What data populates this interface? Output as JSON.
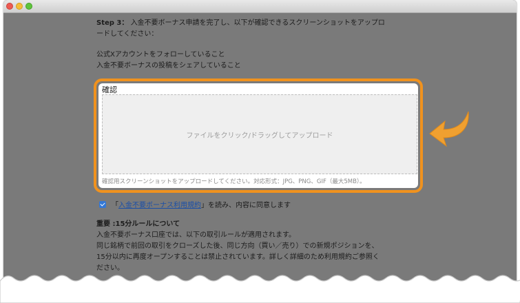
{
  "step": {
    "label": "Step 3",
    "colon": "：",
    "text_line1": "入金不要ボーナス申請を完了し、以下が確認できるスクリーンショットをアップロ",
    "text_line2": "ードしてください："
  },
  "requirements": [
    "公式Xアカウントをフォローしていること",
    "入金不要ボーナスの投稿をシェアしていること"
  ],
  "upload": {
    "label": "確認",
    "dropzone_text": "ファイルをクリック/ドラッグしてアップロード",
    "hint": "確認用スクリーンショットをアップロードしてください。対応形式：JPG、PNG、GIF（最大5MB）。"
  },
  "agreement": {
    "checked": true,
    "open_quote": "「",
    "link_text": "入金不要ボーナス利用規約",
    "close_quote": "」",
    "suffix": "を読み、内容に同意します"
  },
  "rule": {
    "heading": "重要 :15分ルールについて",
    "lines": [
      "入金不要ボーナス口座では、以下の取引ルールが適用されます。",
      "同じ銘柄で前回の取引をクローズした後、同じ方向（買い／売り）での新規ポジションを、",
      "15分以内に再度オープンすることは禁止されています。詳しく詳細のため利用規約ご参照く",
      "ださい。"
    ]
  },
  "colors": {
    "highlight": "#f0921e",
    "arrow": "#f0a030",
    "checkbox": "#3478d6",
    "link": "#1a4fa8"
  }
}
